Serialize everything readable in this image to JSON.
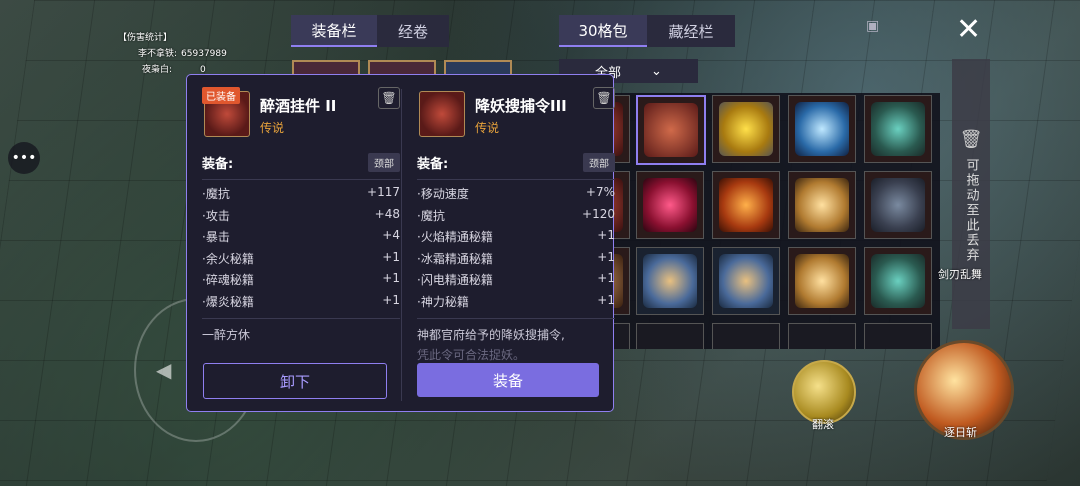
{
  "hud": {
    "damage_stats": {
      "title": "【伤害统计】",
      "rows": [
        {
          "name": "李不拿铁:",
          "value": "65937989"
        },
        {
          "name": "夜枭白:",
          "value": "0"
        }
      ]
    },
    "roll_label": "翻滚",
    "sun_slash_label": "逐日斩",
    "sword_skill_label": "剑刃乱舞"
  },
  "equip_tabs": [
    "装备栏",
    "经卷"
  ],
  "bag_tabs": [
    "30格包",
    "藏经栏"
  ],
  "filter": {
    "label": "全部"
  },
  "discard_zone": {
    "text": "可拖动至此丢弃"
  },
  "colors": {
    "accent": "#8f7ff0",
    "legendary": "#e7a23b",
    "equipped_badge": "#e0572e"
  },
  "popup": {
    "left": {
      "badge": "已装备",
      "name": "醉酒挂件 II",
      "rarity": "传说",
      "slot_label": "装备:",
      "slot_tag": "颈部",
      "stats": [
        {
          "name": "·魔抗",
          "value": "+117"
        },
        {
          "name": "·攻击",
          "value": "+48"
        },
        {
          "name": "·暴击",
          "value": "+4"
        },
        {
          "name": "·余火秘籍",
          "value": "+1"
        },
        {
          "name": "·碎魂秘籍",
          "value": "+1"
        },
        {
          "name": "·爆炎秘籍",
          "value": "+1"
        }
      ],
      "flavor": "一醉方休",
      "button": "卸下"
    },
    "right": {
      "name": "降妖搜捕令III",
      "rarity": "传说",
      "slot_label": "装备:",
      "slot_tag": "颈部",
      "stats": [
        {
          "name": "·移动速度",
          "value": "+7%"
        },
        {
          "name": "·魔抗",
          "value": "+120"
        },
        {
          "name": "·火焰精通秘籍",
          "value": "+1"
        },
        {
          "name": "·冰霜精通秘籍",
          "value": "+1"
        },
        {
          "name": "·闪电精通秘籍",
          "value": "+1"
        },
        {
          "name": "·神力秘籍",
          "value": "+1"
        }
      ],
      "flavor_line1": "神都官府给予的降妖搜捕令,",
      "flavor_line2": "凭此令可合法捉妖。",
      "button": "装备"
    }
  }
}
